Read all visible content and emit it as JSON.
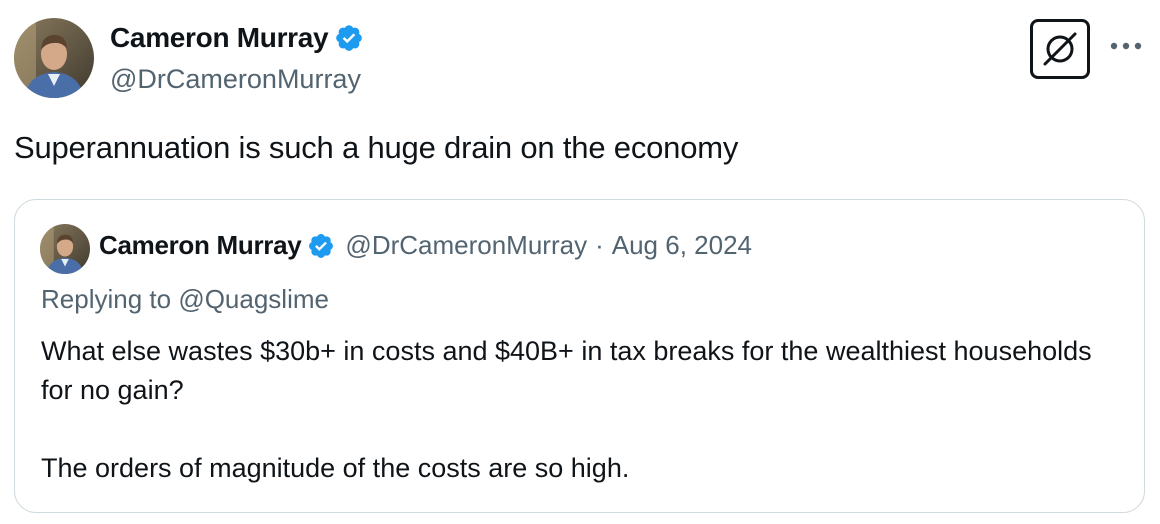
{
  "tweet": {
    "author": {
      "display_name": "Cameron Murray",
      "handle": "@DrCameronMurray",
      "verified": true,
      "avatar_icon": "profile-photo"
    },
    "text": "Superannuation is such a huge drain on the economy",
    "actions": {
      "grok_icon": "grok-icon",
      "more_icon": "more-icon"
    }
  },
  "quoted_tweet": {
    "author": {
      "display_name": "Cameron Murray",
      "handle": "@DrCameronMurray",
      "verified": true
    },
    "separator": "·",
    "date": "Aug 6, 2024",
    "replying_to_prefix": "Replying to",
    "replying_to": "@Quagslime",
    "body_lines": [
      "What else wastes $30b+ in costs and $40B+ in tax breaks for the wealthiest households for no gain?",
      "The orders of magnitude of the costs are so high."
    ]
  },
  "colors": {
    "text_primary": "#0f1419",
    "text_secondary": "#536471",
    "verified_blue": "#1d9bf0",
    "border": "#cfd9de"
  }
}
